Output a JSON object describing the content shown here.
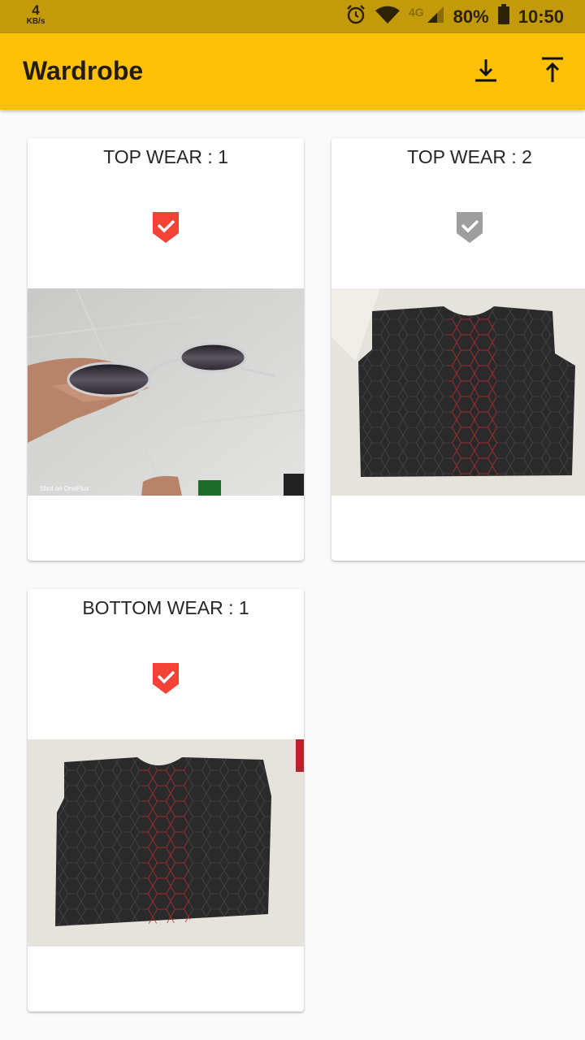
{
  "status_bar": {
    "net_speed_value": "4",
    "net_speed_unit": "KB/s",
    "network_type": "4G",
    "battery": "80%",
    "time": "10:50",
    "icons": [
      "alarm-icon",
      "wifi-icon",
      "signal-icon",
      "battery-icon"
    ]
  },
  "app_bar": {
    "title": "Wardrobe",
    "actions": [
      "download-icon",
      "upload-icon"
    ],
    "color": "#ffc107"
  },
  "cards": [
    {
      "title": "TOP WEAR : 1",
      "selected": true,
      "photo": "sunglasses in hand",
      "photo_caption": "Shot on OnePlus"
    },
    {
      "title": "TOP WEAR : 2",
      "selected": false,
      "photo": "black hexagon pattern t-shirt"
    },
    {
      "title": "BOTTOM WEAR : 1",
      "selected": true,
      "photo": "black hexagon pattern t-shirt"
    }
  ],
  "colors": {
    "check_selected": "#f44336",
    "check_unselected": "#9e9e9e"
  }
}
